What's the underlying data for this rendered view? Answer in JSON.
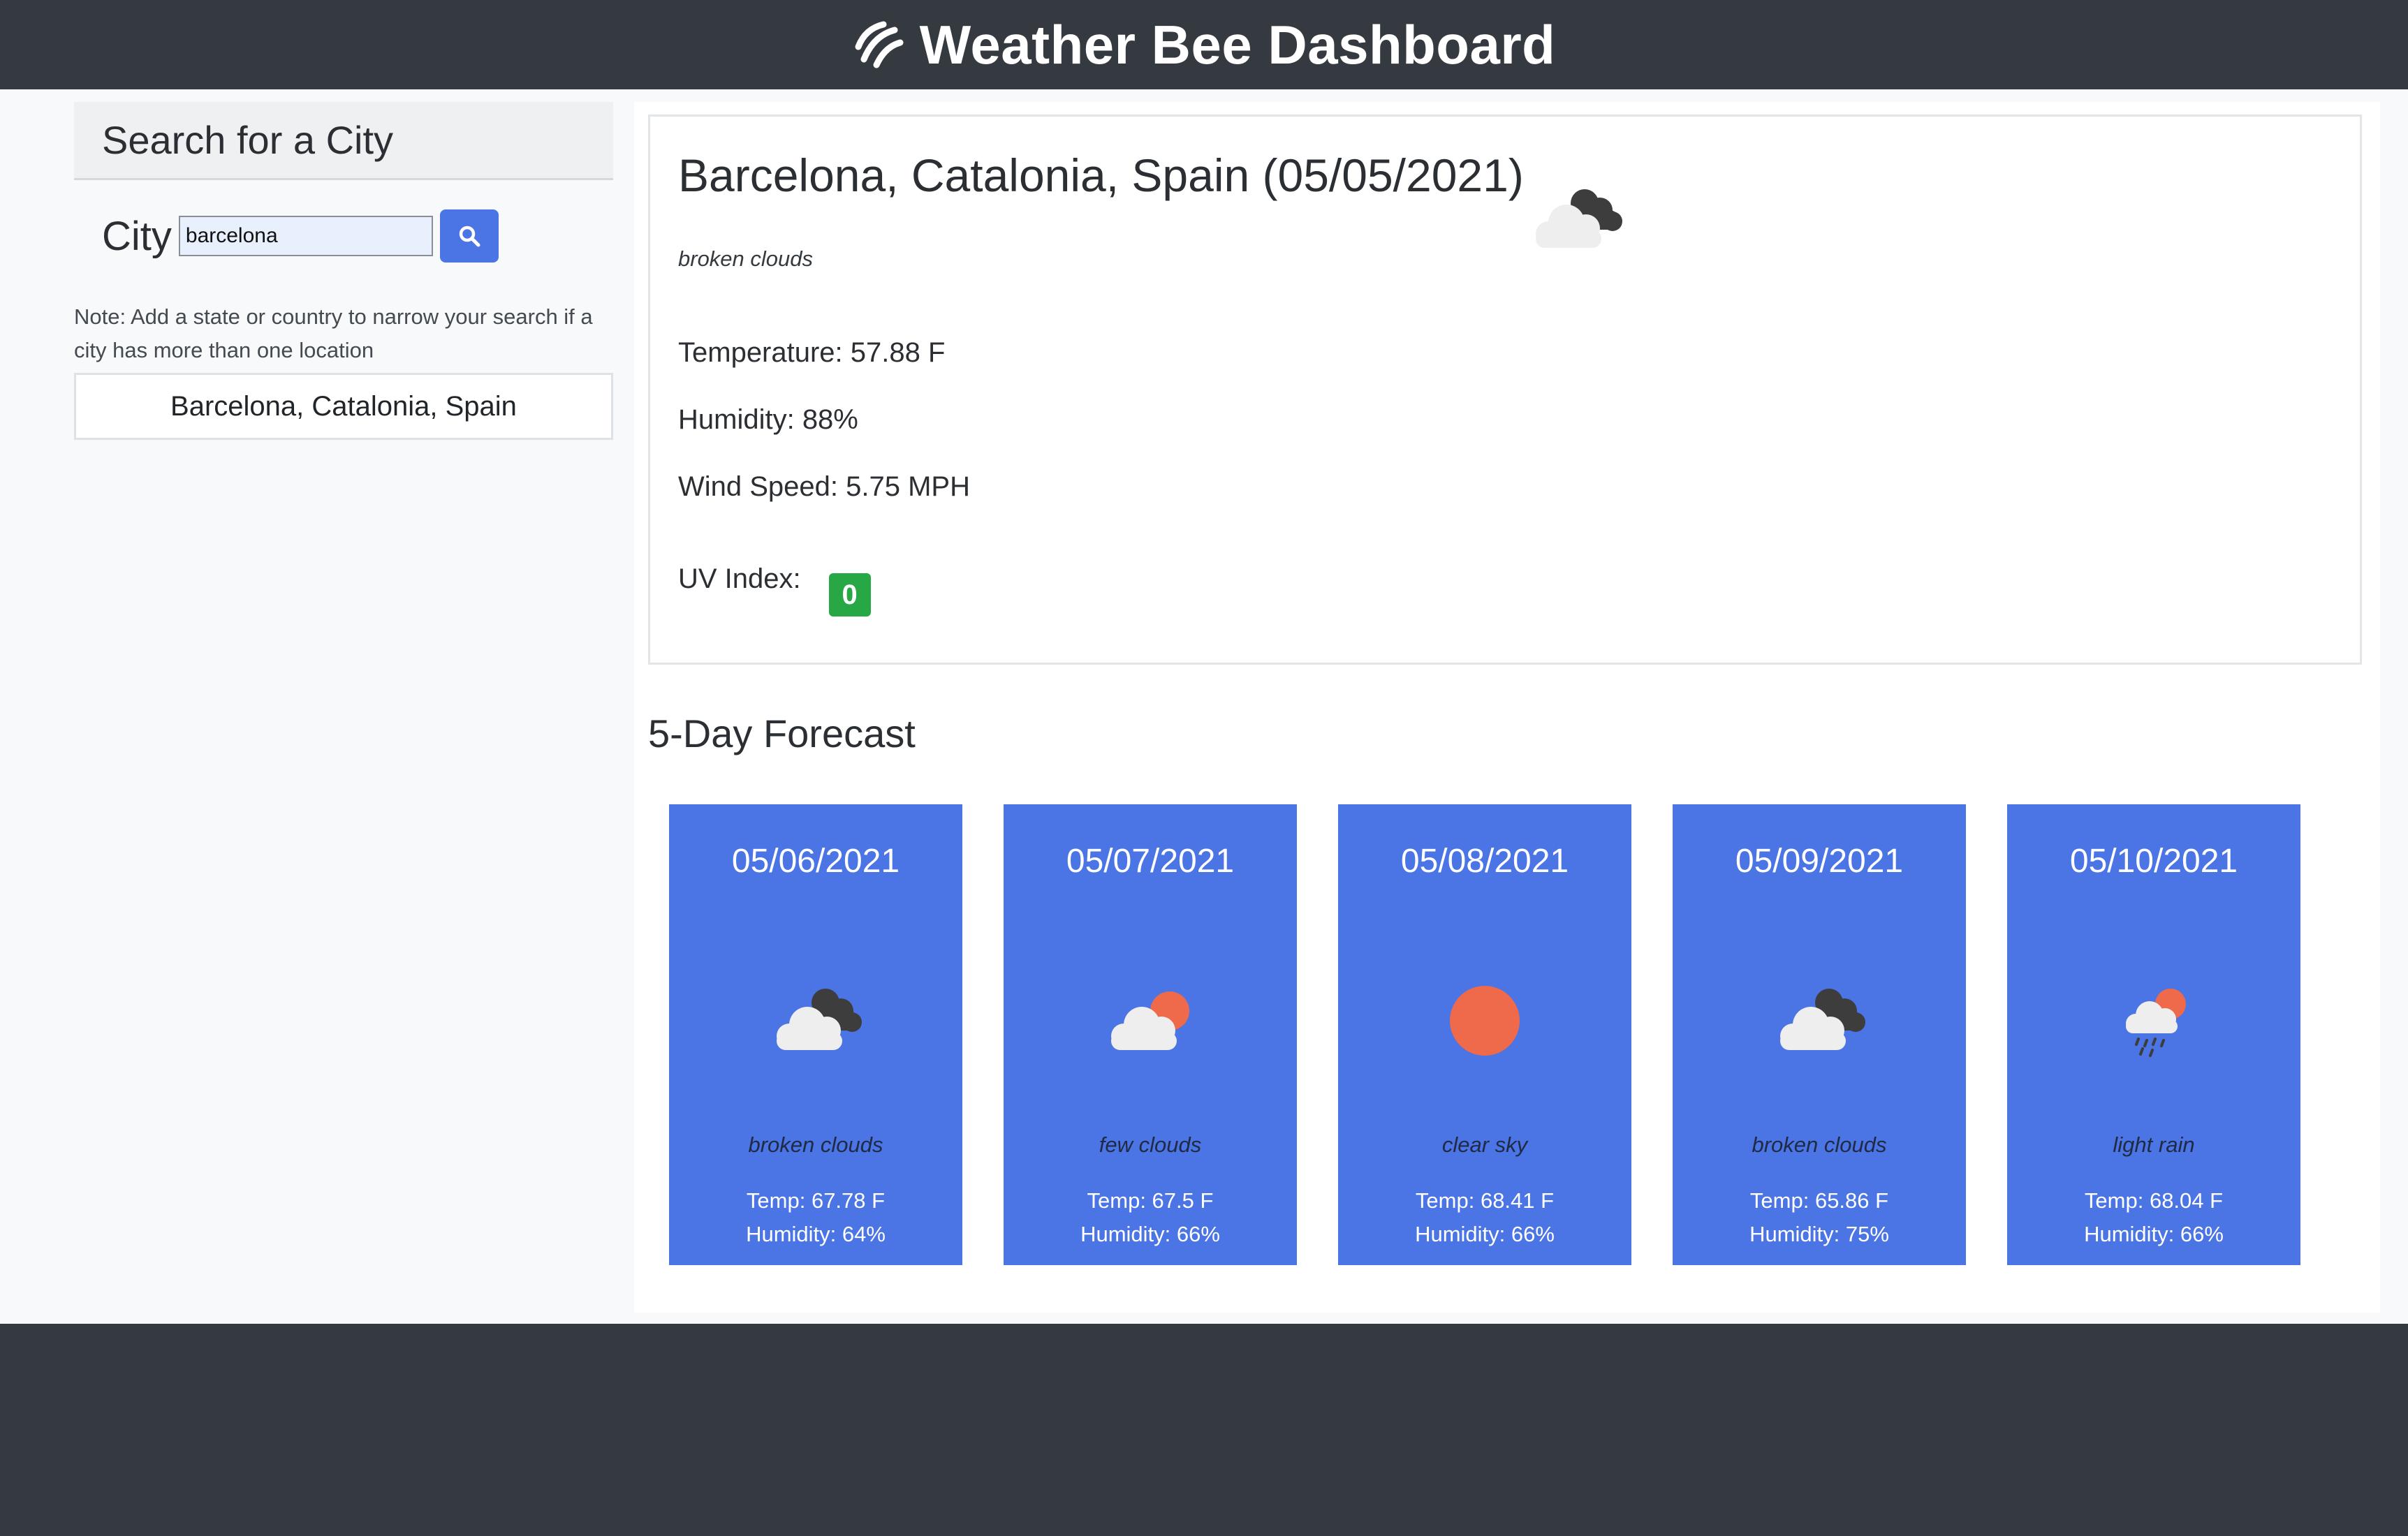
{
  "header": {
    "title": "Weather Bee Dashboard",
    "logo_icon": "bee-stripes-icon"
  },
  "sidebar": {
    "heading": "Search for a City",
    "city_label": "City",
    "search_value": "barcelona",
    "search_icon": "search-icon",
    "note": "Note: Add a state or country to narrow your search if a city has more than one location",
    "history": [
      "Barcelona, Catalonia, Spain"
    ]
  },
  "current": {
    "title": "Barcelona, Catalonia, Spain (05/05/2021)",
    "description": "broken clouds",
    "icon": "broken-clouds-icon",
    "temperature": "Temperature: 57.88 F",
    "humidity": "Humidity: 88%",
    "wind": "Wind Speed: 5.75 MPH",
    "uv_label": "UV Index:",
    "uv_value": "0",
    "uv_color": "#28a745"
  },
  "forecast": {
    "heading": "5-Day Forecast",
    "days": [
      {
        "date": "05/06/2021",
        "icon": "broken-clouds-icon",
        "description": "broken clouds",
        "temp": "Temp: 67.78 F",
        "humidity": "Humidity: 64%"
      },
      {
        "date": "05/07/2021",
        "icon": "few-clouds-icon",
        "description": "few clouds",
        "temp": "Temp: 67.5 F",
        "humidity": "Humidity: 66%"
      },
      {
        "date": "05/08/2021",
        "icon": "clear-sky-icon",
        "description": "clear sky",
        "temp": "Temp: 68.41 F",
        "humidity": "Humidity: 66%"
      },
      {
        "date": "05/09/2021",
        "icon": "broken-clouds-icon",
        "description": "broken clouds",
        "temp": "Temp: 65.86 F",
        "humidity": "Humidity: 75%"
      },
      {
        "date": "05/10/2021",
        "icon": "light-rain-icon",
        "description": "light rain",
        "temp": "Temp: 68.04 F",
        "humidity": "Humidity: 66%"
      }
    ]
  },
  "colors": {
    "navbar": "#343a40",
    "card_blue": "#4b74e4",
    "uv_low": "#28a745",
    "sun": "#ee6a4b"
  }
}
